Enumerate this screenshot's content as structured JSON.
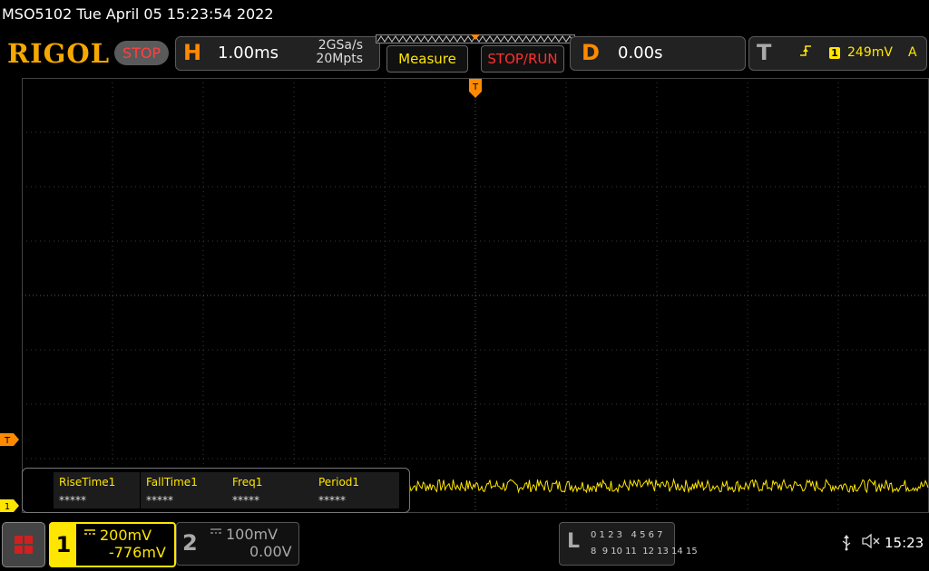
{
  "titlebar": {
    "text": "MSO5102  Tue April 05 15:23:54 2022"
  },
  "header": {
    "logo": "RIGOL",
    "status": "STOP",
    "horizontal": {
      "letter": "H",
      "timebase": "1.00ms",
      "sample_rate": "2GSa/s",
      "memory_depth": "20Mpts"
    },
    "measure_label": "Measure",
    "stoprun_label": "STOP/RUN",
    "delay": {
      "letter": "D",
      "value": "0.00s"
    },
    "trigger": {
      "letter": "T",
      "edge_icon": "rising-edge-icon",
      "source": "1",
      "level": "249mV",
      "mode": "A"
    }
  },
  "markers": {
    "trigger_position": "T",
    "trigger_level": "T",
    "ch1_ground": "1"
  },
  "measurements": [
    {
      "label": "RiseTime1",
      "value": "*****"
    },
    {
      "label": "FallTime1",
      "value": "*****"
    },
    {
      "label": "Freq1",
      "value": "*****"
    },
    {
      "label": "Period1",
      "value": "*****"
    }
  ],
  "channels": {
    "ch1": {
      "number": "1",
      "coupling_icon": "dc-coupling-icon",
      "scale": "200mV",
      "offset": "-776mV"
    },
    "ch2": {
      "number": "2",
      "coupling_icon": "dc-coupling-icon",
      "scale": "100mV",
      "offset": "0.00V"
    }
  },
  "logic_analyzer": {
    "letter": "L",
    "row1": "0 1 2 3   4 5 6 7",
    "row2": "8  9 10 11  12 13 14 15"
  },
  "statusbar": {
    "usb_icon": "usb-icon",
    "sound_icon": "mute-icon",
    "time": "15:23"
  },
  "colors": {
    "ch1": "#ffe600",
    "accent": "#ff8a00",
    "stop": "#ff4040"
  }
}
